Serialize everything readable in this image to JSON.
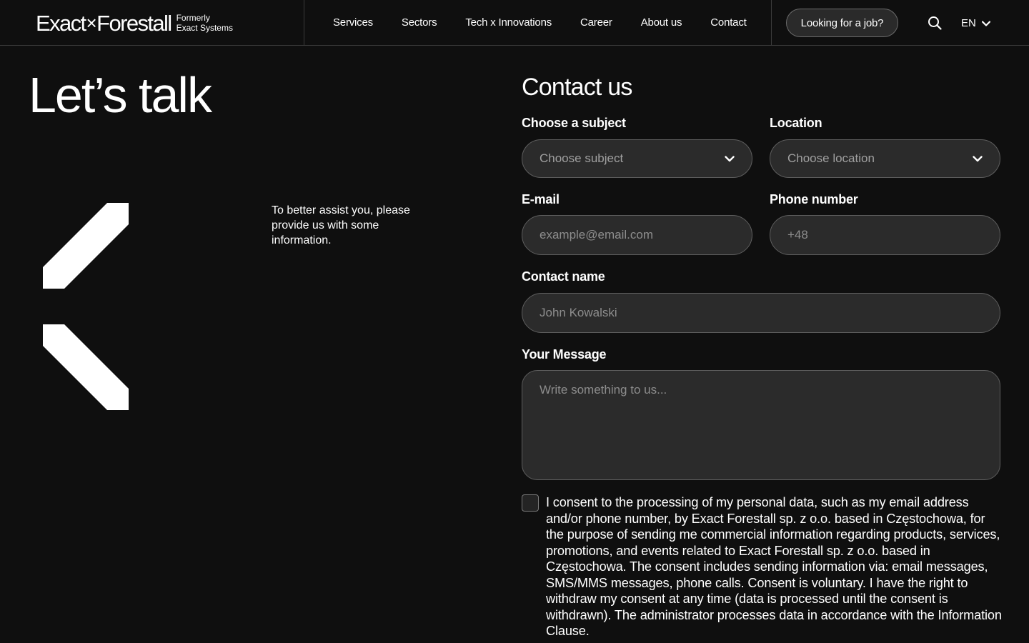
{
  "header": {
    "logo": {
      "brand_left": "Exact",
      "brand_x": "×",
      "brand_right": "Forestall",
      "sub_line1": "Formerly",
      "sub_line2": "Exact Systems"
    },
    "nav": [
      {
        "label": "Services"
      },
      {
        "label": "Sectors"
      },
      {
        "label": "Tech x Innovations"
      },
      {
        "label": "Career"
      },
      {
        "label": "About us"
      },
      {
        "label": "Contact"
      }
    ],
    "job_button_label": "Looking for a job?",
    "search_icon": "search-icon",
    "language": "EN",
    "language_icon": "chevron-down-icon"
  },
  "hero": {
    "title": "Let’s talk",
    "intro": "To better assist you, please provide us with some information.",
    "graphic_icon": "chevron-left-graphic"
  },
  "form": {
    "title": "Contact us",
    "subject": {
      "label": "Choose a subject",
      "value": "Choose subject"
    },
    "location": {
      "label": "Location",
      "value": "Choose location"
    },
    "email": {
      "label": "E-mail",
      "placeholder": "example@email.com"
    },
    "phone": {
      "label": "Phone number",
      "placeholder": "+48"
    },
    "name": {
      "label": "Contact name",
      "placeholder": "John Kowalski"
    },
    "message": {
      "label": "Your Message",
      "placeholder": "Write something to us..."
    },
    "consent": {
      "checked": false,
      "text": "I consent to the processing of my personal data, such as my email address and/or phone number, by Exact Forestall sp. z o.o. based in Częstochowa, for the purpose of sending me commercial information regarding products, services, promotions, and events related to Exact Forestall sp. z o.o. based in Częstochowa. The consent includes sending information via: email messages, SMS/MMS messages, phone calls. Consent is voluntary. I have the right to withdraw my consent at any time (data is processed until the consent is withdrawn). The administrator processes data in accordance with the Information Clause."
    }
  },
  "colors": {
    "background": "#0f0f0f",
    "field_background": "#2b2b2b",
    "field_border": "#5e5e5e",
    "divider": "#3a3a3a",
    "text": "#ffffff",
    "placeholder": "#8d8d8d"
  }
}
